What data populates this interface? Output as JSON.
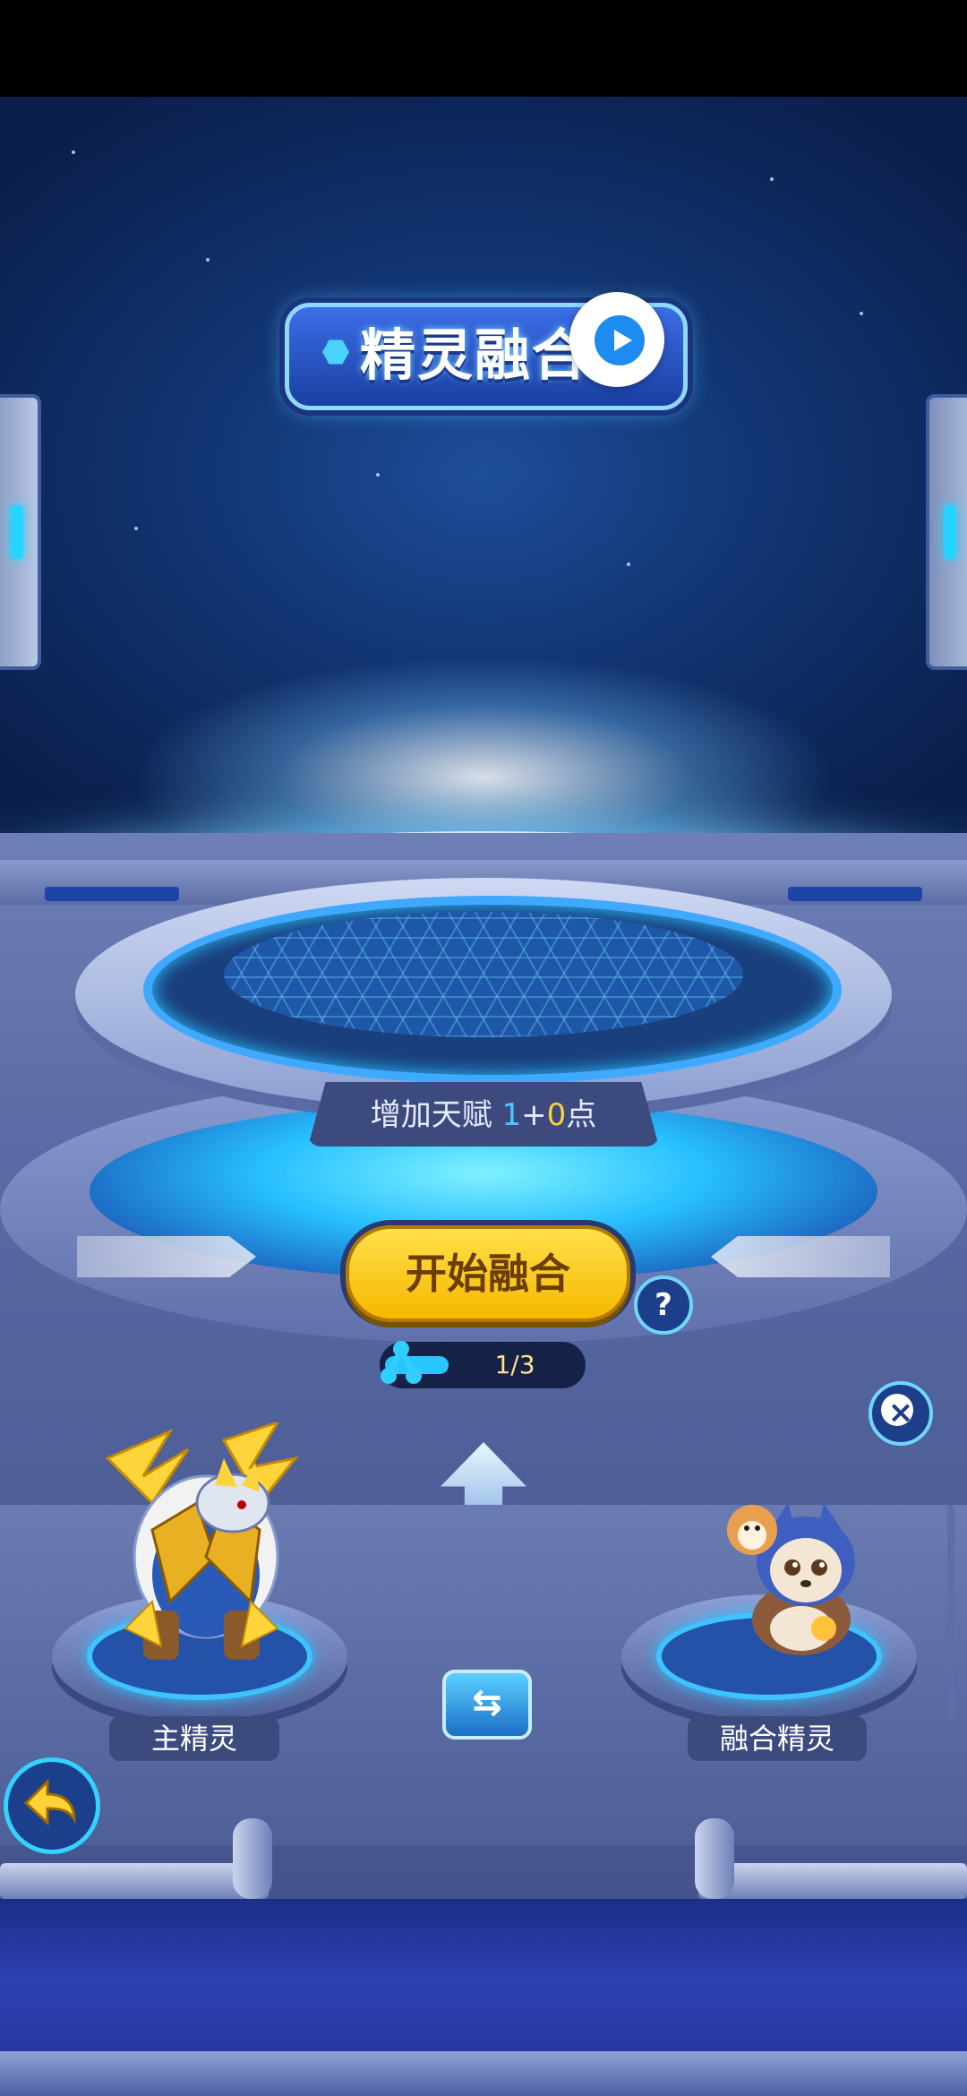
{
  "title": "精灵融合",
  "talent": {
    "prefix": "增加天赋",
    "base": "1",
    "plus": "+",
    "bonus": "0",
    "suffix": "点"
  },
  "start_button": "开始融合",
  "help": "?",
  "progress": {
    "text": "1/3",
    "current": 1,
    "total": 3
  },
  "close": "×",
  "swap": "⇆",
  "slots": {
    "main_label": "主精灵",
    "fuse_label": "融合精灵"
  },
  "colors": {
    "accent": "#29c5ff",
    "button_yellow": "#ffd23a",
    "title_blue": "#1a3fa3"
  },
  "icons": [
    "play-icon",
    "help-icon",
    "close-icon",
    "up-arrow-icon",
    "swap-icon",
    "back-arrow-icon"
  ]
}
